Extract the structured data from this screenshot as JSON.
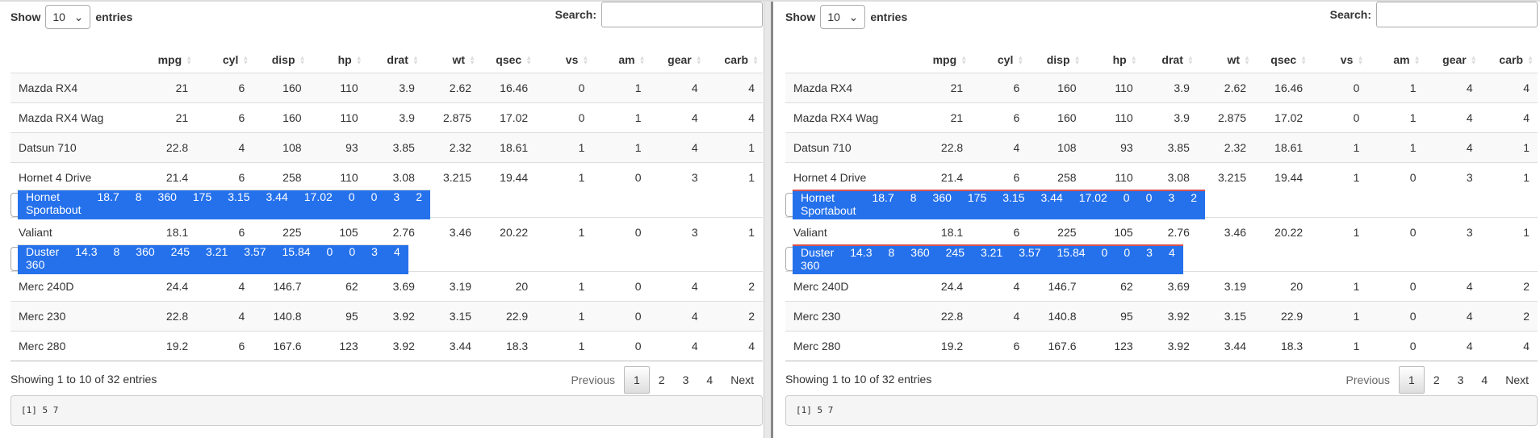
{
  "controls": {
    "show": "Show",
    "entries_value": "10",
    "entries": "entries",
    "search": "Search:",
    "search_value": ""
  },
  "columns": [
    "",
    "mpg",
    "cyl",
    "disp",
    "hp",
    "drat",
    "wt",
    "qsec",
    "vs",
    "am",
    "gear",
    "carb"
  ],
  "rows": [
    [
      "Mazda RX4",
      "21",
      "6",
      "160",
      "110",
      "3.9",
      "2.62",
      "16.46",
      "0",
      "1",
      "4",
      "4"
    ],
    [
      "Mazda RX4 Wag",
      "21",
      "6",
      "160",
      "110",
      "3.9",
      "2.875",
      "17.02",
      "0",
      "1",
      "4",
      "4"
    ],
    [
      "Datsun 710",
      "22.8",
      "4",
      "108",
      "93",
      "3.85",
      "2.32",
      "18.61",
      "1",
      "1",
      "4",
      "1"
    ],
    [
      "Hornet 4 Drive",
      "21.4",
      "6",
      "258",
      "110",
      "3.08",
      "3.215",
      "19.44",
      "1",
      "0",
      "3",
      "1"
    ],
    [
      "Hornet Sportabout",
      "18.7",
      "8",
      "360",
      "175",
      "3.15",
      "3.44",
      "17.02",
      "0",
      "0",
      "3",
      "2"
    ],
    [
      "Valiant",
      "18.1",
      "6",
      "225",
      "105",
      "2.76",
      "3.46",
      "20.22",
      "1",
      "0",
      "3",
      "1"
    ],
    [
      "Duster 360",
      "14.3",
      "8",
      "360",
      "245",
      "3.21",
      "3.57",
      "15.84",
      "0",
      "0",
      "3",
      "4"
    ],
    [
      "Merc 240D",
      "24.4",
      "4",
      "146.7",
      "62",
      "3.69",
      "3.19",
      "20",
      "1",
      "0",
      "4",
      "2"
    ],
    [
      "Merc 230",
      "22.8",
      "4",
      "140.8",
      "95",
      "3.92",
      "3.15",
      "22.9",
      "1",
      "0",
      "4",
      "2"
    ],
    [
      "Merc 280",
      "19.2",
      "6",
      "167.6",
      "123",
      "3.92",
      "3.44",
      "18.3",
      "1",
      "0",
      "4",
      "4"
    ]
  ],
  "selected_rows": [
    4,
    6
  ],
  "highlight_color": "#2571ec",
  "footer": {
    "info": "Showing 1 to 10 of 32 entries",
    "previous": "Previous",
    "pages": [
      "1",
      "2",
      "3",
      "4"
    ],
    "current_page": "1",
    "next": "Next"
  },
  "output": "[1] 5 7"
}
